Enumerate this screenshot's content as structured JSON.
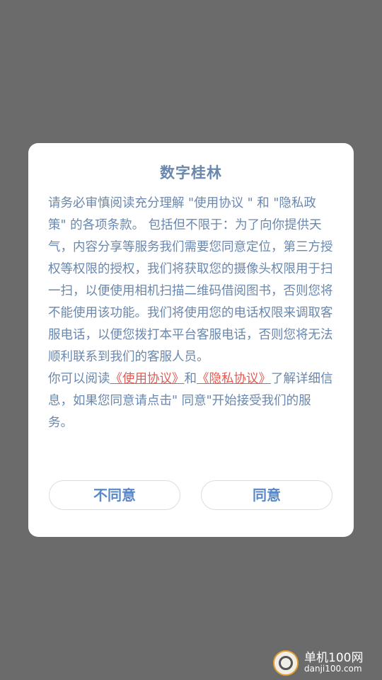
{
  "dialog": {
    "title": "数字桂林",
    "paragraph1": "请务必审慎阅读充分理解 \"使用协议 \" 和 \"隐私政策\" 的各项条款。 包括但不限于：为了向你提供天气，内容分享等服务我们需要您同意定位，第三方授权等权限的授权，我们将获取您的摄像头权限用于扫一扫，以便使用相机扫描二维码借阅图书，否则您将不能使用该功能。我们将使用您的电话权限来调取客服电话，以便您拨打本平台客服电话，否则您将无法顺利联系到我们的客服人员。",
    "p2_prefix": "你可以阅读",
    "link_terms": "《使用协议》",
    "p2_and": "和",
    "link_privacy": "《隐私协议》",
    "p2_suffix": "了解详细信息，如果您同意请点击\" 同意\"开始接受我们的服务。",
    "disagree_label": "不同意",
    "agree_label": "同意"
  },
  "watermark": {
    "line1": "单机100网",
    "line2": "danji100.com"
  },
  "colors": {
    "overlay": "#6b6b6b",
    "text": "#6a87ad",
    "link": "#e25a52",
    "button_text": "#5a88c9"
  }
}
